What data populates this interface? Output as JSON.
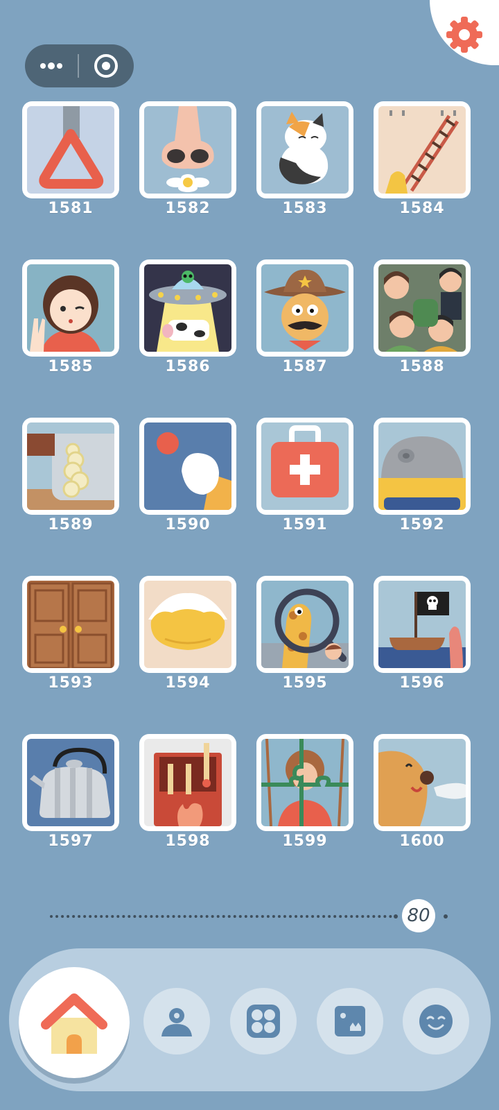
{
  "header": {
    "settings_icon": "gear-icon",
    "capsule": {
      "more_icon": "more-dots-icon",
      "close_icon": "target-circle-icon"
    }
  },
  "levels": [
    {
      "number": "1581",
      "art": "hand-strap"
    },
    {
      "number": "1582",
      "art": "nose-flower"
    },
    {
      "number": "1583",
      "art": "calico-cat"
    },
    {
      "number": "1584",
      "art": "rope-ladder"
    },
    {
      "number": "1585",
      "art": "girl-wink"
    },
    {
      "number": "1586",
      "art": "ufo-cow"
    },
    {
      "number": "1587",
      "art": "cowboy"
    },
    {
      "number": "1588",
      "art": "crowd"
    },
    {
      "number": "1589",
      "art": "knife-onion"
    },
    {
      "number": "1590",
      "art": "paw-sun"
    },
    {
      "number": "1591",
      "art": "first-aid-kit"
    },
    {
      "number": "1592",
      "art": "helmet"
    },
    {
      "number": "1593",
      "art": "wooden-door"
    },
    {
      "number": "1594",
      "art": "dumpling"
    },
    {
      "number": "1595",
      "art": "giraffe-magnifier"
    },
    {
      "number": "1596",
      "art": "pirate-boat"
    },
    {
      "number": "1597",
      "art": "kettle"
    },
    {
      "number": "1598",
      "art": "matchbox"
    },
    {
      "number": "1599",
      "art": "puzzle-portrait"
    },
    {
      "number": "1600",
      "art": "seal"
    }
  ],
  "progress": {
    "value": "80"
  },
  "navbar": {
    "items": [
      {
        "name": "home",
        "icon": "house-icon",
        "active": true
      },
      {
        "name": "profile",
        "icon": "user-icon"
      },
      {
        "name": "levels",
        "icon": "grid-circles-icon"
      },
      {
        "name": "collection",
        "icon": "monster-card-icon"
      },
      {
        "name": "emoji",
        "icon": "smile-icon"
      }
    ]
  },
  "colors": {
    "background": "#7fa3c0",
    "accent": "#ef6b57",
    "navbar": "#b8cee0",
    "text_dark": "#3f4f5c"
  }
}
